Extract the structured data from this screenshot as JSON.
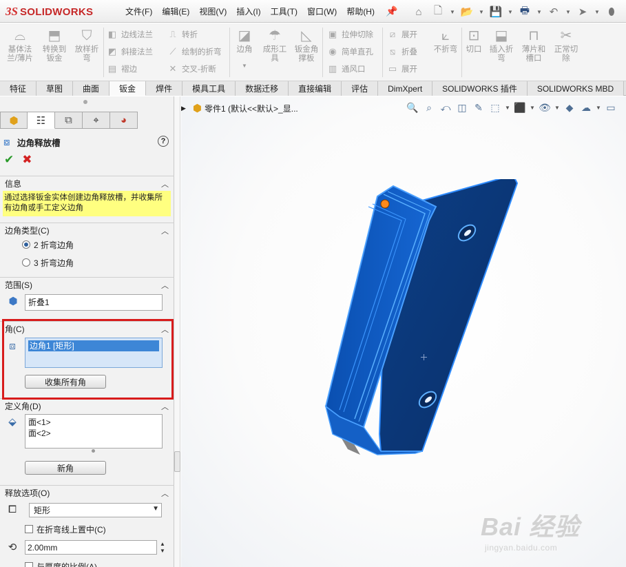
{
  "app": {
    "logo_ds": "3S",
    "brand": "SOLIDWORKS"
  },
  "menu": [
    "文件(F)",
    "编辑(E)",
    "视图(V)",
    "插入(I)",
    "工具(T)",
    "窗口(W)",
    "帮助(H)"
  ],
  "ribbon": {
    "base_flange": "基体法\n兰/薄片",
    "convert_to_sheet": "转换到\n钣金",
    "lofted_bend": "放样折\n弯",
    "edge_flange": "边线法兰",
    "miter_flange": "斜接法兰",
    "hem": "褶边",
    "jog": "转折",
    "sketched_bend": "绘制的折弯",
    "cross_break": "交叉-折断",
    "corners": "边角",
    "forming_tool": "成形工\n具",
    "sheet_metal_gusset": "钣金角\n撑板",
    "extruded_cut": "拉伸切除",
    "simple_hole": "简单直孔",
    "vent": "通风口",
    "unfold": "展开",
    "fold": "折叠",
    "flatten": "展开",
    "no_bends": "不折弯",
    "cut": "切口",
    "insert_bends": "插入折\n弯",
    "tab_and_slot": "薄片和\n槽口",
    "normal_cut": "正常切\n除"
  },
  "tabs": [
    "特征",
    "草图",
    "曲面",
    "钣金",
    "焊件",
    "模具工具",
    "数据迁移",
    "直接编辑",
    "评估",
    "DimXpert",
    "SOLIDWORKS 插件",
    "SOLIDWORKS MBD"
  ],
  "active_tab": "钣金",
  "property_manager": {
    "title": "边角释放槽",
    "info": {
      "header": "信息",
      "text": "通过选择钣金实体创建边角释放槽，并收集所有边角或手工定义边角"
    },
    "corner_type": {
      "header": "边角类型(C)",
      "option_2": "2 折弯边角",
      "option_3": "3 折弯边角",
      "selected": "2 折弯边角"
    },
    "scope": {
      "header": "范围(S)",
      "value": "折叠1"
    },
    "corners": {
      "header": "角(C)",
      "list": [
        "边角1 [矩形]"
      ],
      "collect_button": "收集所有角"
    },
    "define_corner": {
      "header": "定义角(D)",
      "faces": [
        "面<1>",
        "面<2>"
      ],
      "new_corner_button": "新角"
    },
    "relief_options": {
      "header": "释放选项(O)",
      "type": "矩形",
      "center_on_bend": "在折弯线上置中(C)",
      "distance": "2.00mm",
      "ratio_to_thickness": "与厚度的比例(A)"
    }
  },
  "viewport": {
    "tree_item": "零件1  (默认<<默认>_显...",
    "watermark_main": "Bai 经验",
    "watermark_url": "jingyan.baidu.com"
  },
  "colors": {
    "part_blue": "#0c56b8",
    "part_dark": "#083a80",
    "highlight_yellow": "#ffff80",
    "annotation_red": "#d81b1b"
  }
}
